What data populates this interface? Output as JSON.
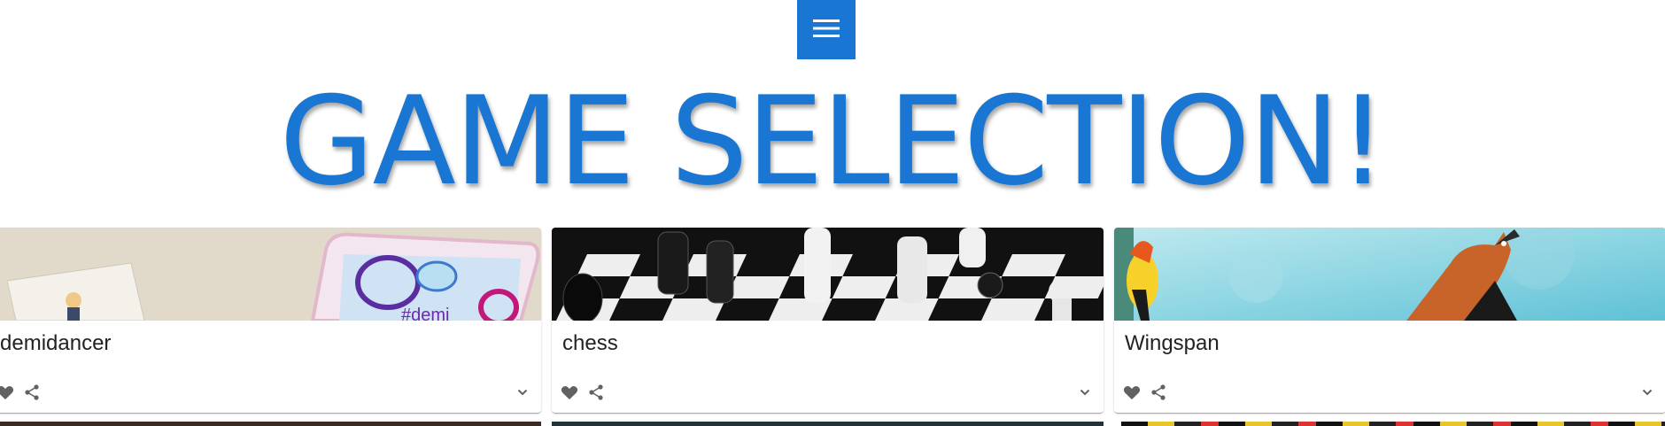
{
  "header": {
    "menu_icon": "hamburger-menu-icon",
    "title": "GAME SELECTION!"
  },
  "colors": {
    "primary": "#1976d2",
    "icon_gray": "#616161"
  },
  "cards": [
    {
      "title": "demidancer",
      "image": "demidancer-box-photo",
      "actions": [
        "heart-icon",
        "share-icon",
        "expand-icon"
      ]
    },
    {
      "title": "chess",
      "image": "chess-board-photo",
      "actions": [
        "heart-icon",
        "share-icon",
        "expand-icon"
      ]
    },
    {
      "title": "Wingspan",
      "image": "wingspan-bird-art",
      "actions": [
        "heart-icon",
        "share-icon",
        "expand-icon"
      ]
    }
  ]
}
